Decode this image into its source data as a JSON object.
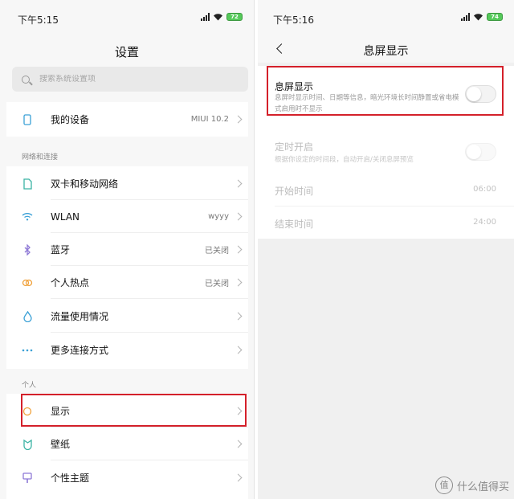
{
  "left": {
    "status": {
      "time": "下午5:15",
      "battery": "72"
    },
    "title": "设置",
    "search": {
      "placeholder": "搜索系统设置项"
    },
    "my_device": {
      "label": "我的设备",
      "value": "MIUI 10.2"
    },
    "network_section": "网络和连接",
    "network_items": [
      {
        "label": "双卡和移动网络",
        "value": "",
        "icon": "sim-card-icon"
      },
      {
        "label": "WLAN",
        "value": "wyyy",
        "icon": "wifi-icon"
      },
      {
        "label": "蓝牙",
        "value": "已关闭",
        "icon": "bluetooth-icon"
      },
      {
        "label": "个人热点",
        "value": "已关闭",
        "icon": "hotspot-icon"
      },
      {
        "label": "流量使用情况",
        "value": "",
        "icon": "data-usage-icon"
      },
      {
        "label": "更多连接方式",
        "value": "",
        "icon": "more-dots-icon"
      }
    ],
    "personal_section": "个人",
    "personal_items": [
      {
        "label": "显示",
        "icon": "display-icon"
      },
      {
        "label": "壁纸",
        "icon": "wallpaper-icon"
      },
      {
        "label": "个性主题",
        "icon": "theme-icon"
      }
    ]
  },
  "right": {
    "status": {
      "time": "下午5:16",
      "battery": "74"
    },
    "back_icon": "chevron-left-icon",
    "title": "息屏显示",
    "aod": {
      "title": "息屏显示",
      "description": "息屏时显示时间、日期等信息，暗光环境长时间静置或省电模式启用时不显示",
      "enabled": false
    },
    "scheduled": {
      "title": "定时开启",
      "description": "根据你设定的时间段，自动开启/关闭息屏预览",
      "enabled": false
    },
    "start_time": {
      "label": "开始时间",
      "value": "06:00"
    },
    "end_time": {
      "label": "结束时间",
      "value": "24:00"
    }
  },
  "colors": {
    "highlight": "#d4202a",
    "battery": "#55c95a",
    "icon_teal": "#3bb3a5",
    "icon_purple": "#8e79d6",
    "icon_orange": "#f0a23c",
    "icon_blue": "#3aa0d6"
  },
  "watermark": {
    "text": "什么值得买",
    "glyph": "值"
  }
}
